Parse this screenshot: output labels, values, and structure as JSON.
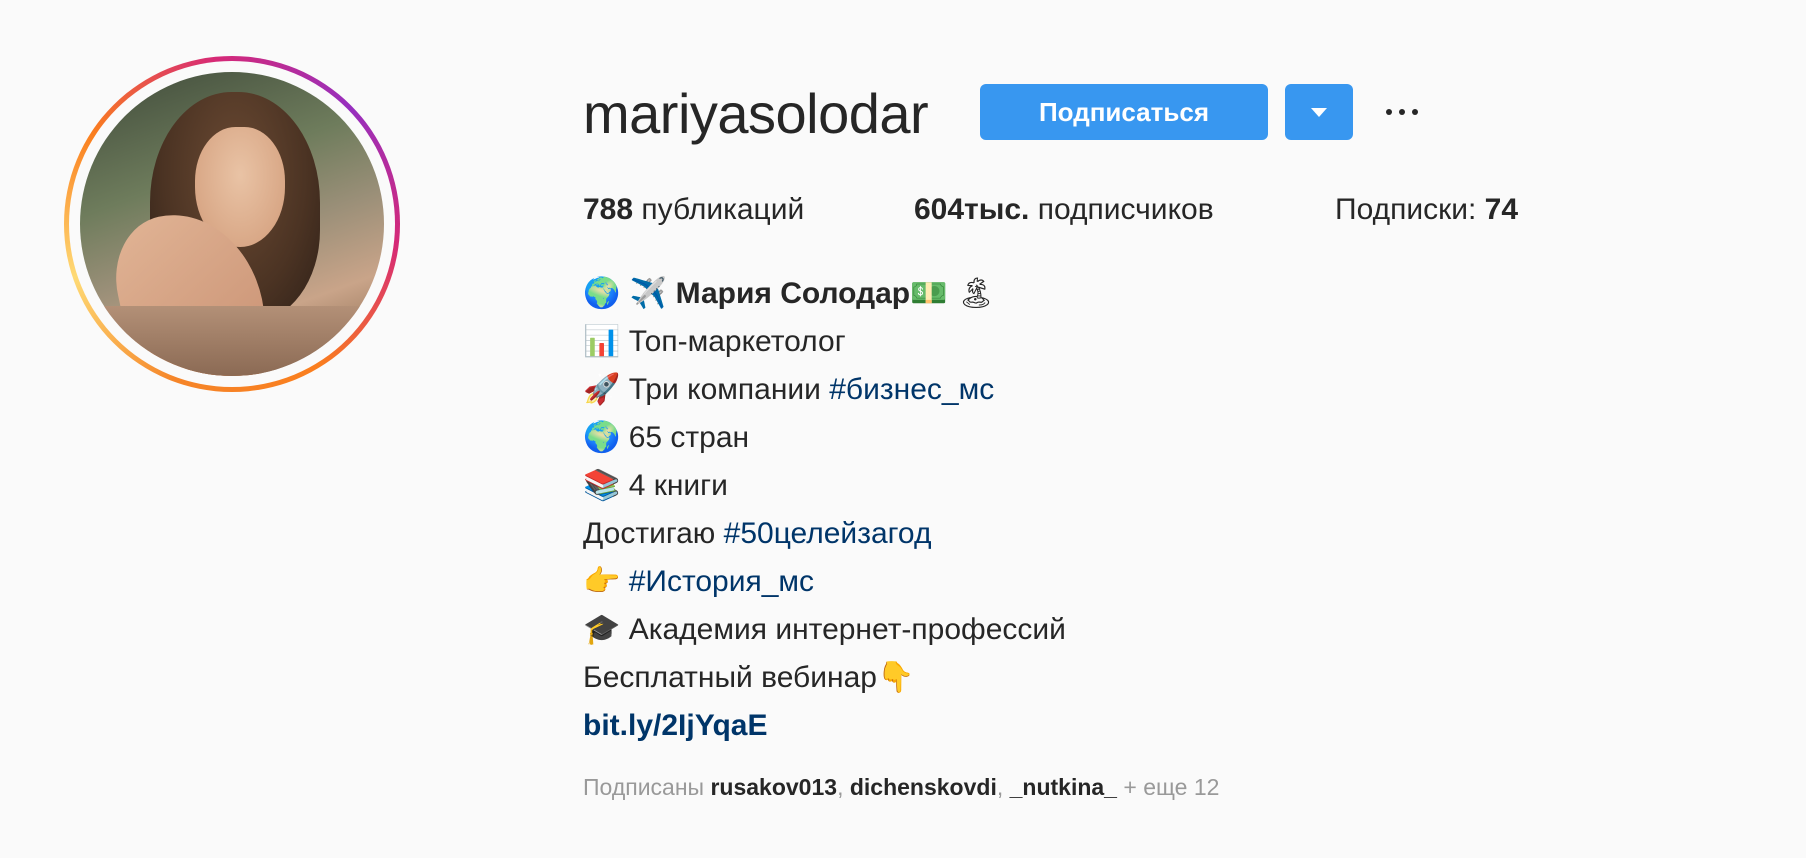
{
  "profile": {
    "username": "mariyasolodar",
    "follow_button": "Подписаться",
    "dropdown_icon": "caret-down-icon",
    "more_icon": "ellipsis-icon"
  },
  "stats": {
    "posts_count": "788",
    "posts_label": "публикаций",
    "followers_count": "604тыс.",
    "followers_label": "подписчиков",
    "following_label": "Подписки:",
    "following_count": "74"
  },
  "bio": {
    "line1_emoji": "🌍 ✈️",
    "line1_name": "Мария Солодар",
    "line1_emoji_end": "💵 🏝",
    "line2_emoji": "📊",
    "line2_text": "Топ-маркетолог",
    "line3_emoji": "🚀",
    "line3_text": "Три компании",
    "line3_tag": "#бизнес_мс",
    "line4_emoji": "🌍",
    "line4_text": "65 стран",
    "line5_emoji": "📚",
    "line5_text": "4 книги",
    "line6_text": "Достигаю",
    "line6_tag": "#50целейзагод",
    "line7_emoji": "👉",
    "line7_tag": "#История_мс",
    "line8_emoji": "🎓",
    "line8_text": "Академия интернет-профессий",
    "line9_text": "Бесплатный вебинар",
    "line9_emoji": "👇",
    "link": "bit.ly/2IjYqaE"
  },
  "followed_by": {
    "prefix": "Подписаны",
    "user1": "rusakov013",
    "sep1": ",",
    "user2": "dichenskovdi",
    "sep2": ",",
    "user3": "_nutkina_",
    "suffix": "+ еще 12"
  },
  "colors": {
    "accent": "#3897f0",
    "hashtag": "#003569",
    "muted": "#999999",
    "text": "#262626",
    "background": "#fafafa"
  }
}
